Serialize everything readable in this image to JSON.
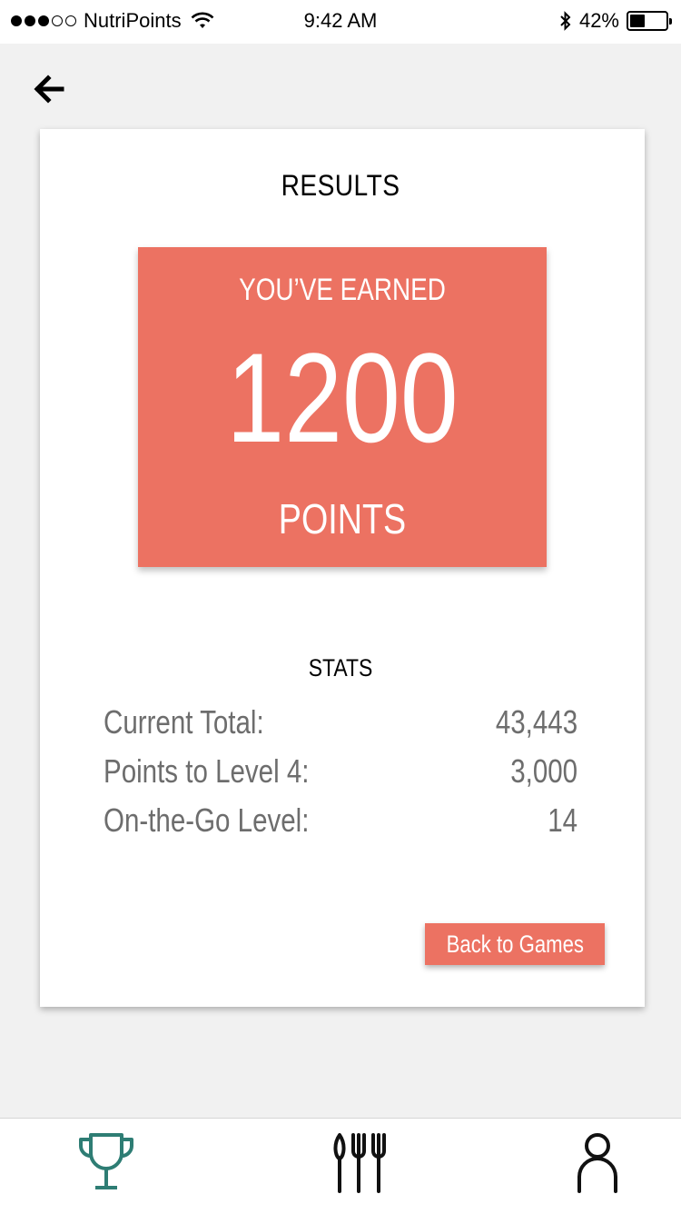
{
  "status_bar": {
    "carrier": "NutriPoints",
    "time": "9:42 AM",
    "battery": "42%",
    "battery_level": 0.42,
    "signal_bars": 3,
    "signal_total": 5
  },
  "nav": {
    "back_icon": "arrow-left-icon"
  },
  "results": {
    "title": "RESULTS",
    "earned_label": "YOU’VE EARNED",
    "points_value": "1200",
    "points_unit": "POINTS",
    "accent_color": "#ec7262"
  },
  "stats": {
    "title": "STATS",
    "rows": [
      {
        "label": "Current Total:",
        "value": "43,443"
      },
      {
        "label": "Points to Level 4:",
        "value": "3,000"
      },
      {
        "label": "On-the-Go Level:",
        "value": "14"
      }
    ]
  },
  "actions": {
    "back_to_games": "Back to Games"
  },
  "tab_bar": {
    "items": [
      {
        "icon": "trophy-icon",
        "active": true,
        "color": "#2e7d74"
      },
      {
        "icon": "fork-knife-icon",
        "active": false,
        "color": "#111111"
      },
      {
        "icon": "profile-icon",
        "active": false,
        "color": "#111111"
      }
    ]
  }
}
